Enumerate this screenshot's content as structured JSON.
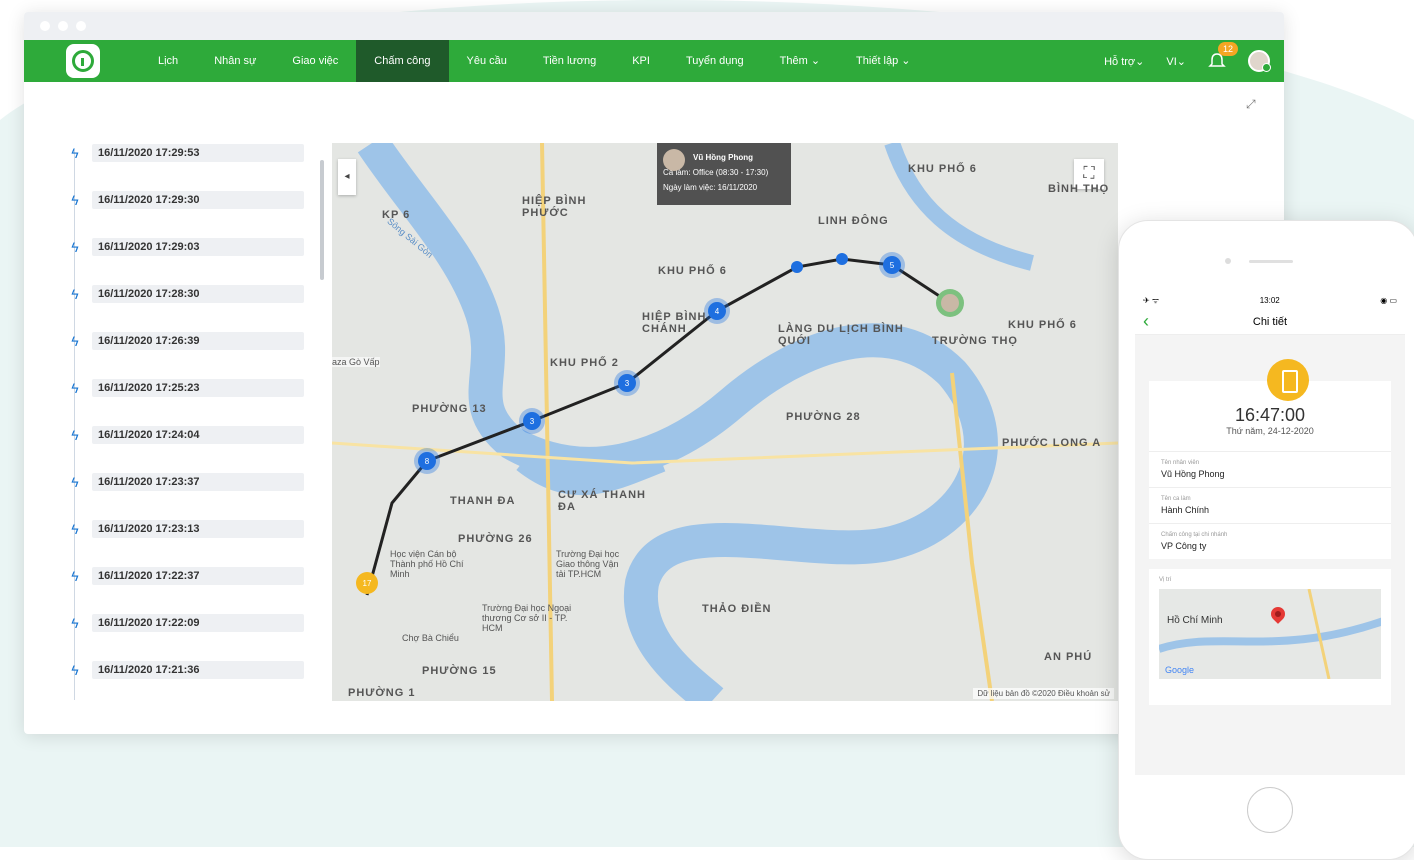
{
  "nav": {
    "items": [
      "Lịch",
      "Nhân sự",
      "Giao việc",
      "Chấm công",
      "Yêu cầu",
      "Tiền lương",
      "KPI",
      "Tuyển dụng",
      "Thêm ⌄",
      "Thiết lập ⌄"
    ],
    "active_index": 3,
    "help": "Hỗ trợ⌄",
    "lang": "VI⌄",
    "notifications": "12"
  },
  "log": {
    "times": [
      "16/11/2020 17:29:53",
      "16/11/2020 17:29:30",
      "16/11/2020 17:29:03",
      "16/11/2020 17:28:30",
      "16/11/2020 17:26:39",
      "16/11/2020 17:25:23",
      "16/11/2020 17:24:04",
      "16/11/2020 17:23:37",
      "16/11/2020 17:23:13",
      "16/11/2020 17:22:37",
      "16/11/2020 17:22:09",
      "16/11/2020 17:21:36"
    ]
  },
  "map": {
    "tooltip": {
      "name": "Vũ Hồng Phong",
      "shift": "Ca làm: Office (08:30 - 17:30)",
      "workday": "Ngày làm việc: 16/11/2020"
    },
    "labels": {
      "khu_pho_6_top": "KHU PHỐ 6",
      "hiep_binh_phuoc": "HIỆP BÌNH PHƯỚC",
      "kp6": "KP 6",
      "linh_dong": "LINH ĐÔNG",
      "binh_tho": "BÌNH THỌ",
      "khu_pho_6_mid": "KHU PHỐ 6",
      "hiep_binh_chanh": "HIỆP BÌNH CHÁNH",
      "lang_du_lich": "LÀNG DU LỊCH BÌNH QUỚI",
      "truong_tho": "TRƯỜNG THỌ",
      "khu_pho_6_right": "KHU PHỐ 6",
      "khu_pho_2": "KHU PHỐ 2",
      "phuong_13": "PHƯỜNG 13",
      "phuong_28": "PHƯỜNG 28",
      "phuoc_long_a": "PHƯỚC LONG A",
      "thanh_da": "THANH ĐA",
      "cu_xa_thanh_da": "CƯ XÁ THANH ĐA",
      "phuong_26": "PHƯỜNG 26",
      "hoc_vien": "Học viện Cán bộ Thành phố Hồ Chí Minh",
      "truong_dai_hoc_gtvt": "Trường Đại học Giao thông Vận tải TP.HCM",
      "thao_dien": "THẢO ĐIỀN",
      "truong_ngoai_thuong": "Trường Đại học Ngoại thương Cơ sở II - TP. HCM",
      "cho_ba_chieu": "Chợ Bà Chiểu",
      "phuong_15": "PHƯỜNG 15",
      "an_phu": "AN PHÚ",
      "phuong_1": "PHƯỜNG 1",
      "go_vap": "aza Gò Vấp",
      "song_sai_gon": "Sông Sài Gòn"
    },
    "clusters": [
      "17",
      "8",
      "3",
      "3",
      "4",
      "5"
    ],
    "footer": "Dữ liệu bản đồ ©2020   Điều khoản sử"
  },
  "phone": {
    "time": "13:02",
    "title": "Chi tiết",
    "check_time": "16:47:00",
    "check_date": "Thứ năm, 24-12-2020",
    "fields": [
      {
        "label": "Tên nhân viên",
        "value": "Vũ Hồng Phong"
      },
      {
        "label": "Tên ca làm",
        "value": "Hành Chính"
      },
      {
        "label": "Chấm công tại chi nhánh",
        "value": "VP Công ty"
      }
    ],
    "location_label": "Vị trí",
    "city": "Hồ Chí Minh",
    "google": "Google"
  },
  "colors": {
    "brand_green": "#2eaa3a",
    "active_nav": "#1f5a2a",
    "cluster_blue": "#1e6fe0",
    "cluster_orange": "#f5b820"
  }
}
